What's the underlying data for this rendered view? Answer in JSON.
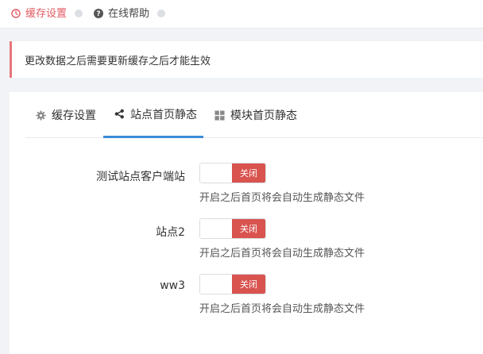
{
  "top_tabs": [
    {
      "label": "缓存设置",
      "icon": "clock-icon",
      "active": true
    },
    {
      "label": "在线帮助",
      "icon": "help-circle-icon",
      "active": false
    }
  ],
  "notice": {
    "text": "更改数据之后需要更新缓存之后才能生效"
  },
  "inner_tabs": [
    {
      "label": "缓存设置",
      "icon": "gear-icon"
    },
    {
      "label": "站点首页静态",
      "icon": "share-icon",
      "active": true
    },
    {
      "label": "模块首页静态",
      "icon": "grid-icon"
    }
  ],
  "sites": [
    {
      "label": "测试站点客户端站",
      "switch_label": "关闭",
      "help": "开启之后首页将会自动生成静态文件"
    },
    {
      "label": "站点2",
      "switch_label": "关闭",
      "help": "开启之后首页将会自动生成静态文件"
    },
    {
      "label": "ww3",
      "switch_label": "关闭",
      "help": "开启之后首页将会自动生成静态文件"
    }
  ],
  "colors": {
    "accent": "#e25b61",
    "tab_underline": "#3b8bd8",
    "switch_off": "#d9534f"
  }
}
